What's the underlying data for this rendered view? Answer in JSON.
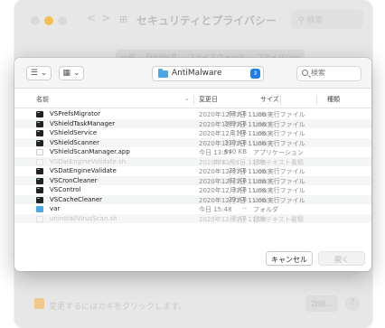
{
  "background": {
    "nav_back": "<",
    "nav_forward": ">",
    "grid_glyph": "⊞",
    "title": "セキュリティとプライバシー",
    "search_placeholder": "検索",
    "tabs": [
      "一般",
      "FileVault",
      "ファイアウォール",
      "プライバシー"
    ],
    "lock_text": "変更するにはカギをクリックします。",
    "advanced_label": "詳細...",
    "help_label": "?"
  },
  "toolbar": {
    "view_icon": "list-view-icon",
    "grid_icon": "grid-view-icon",
    "view_glyph": "☰",
    "grid_glyph": "▦",
    "chevron": "⌄",
    "location": "AntiMalware",
    "location_stepper": "⇕",
    "search_placeholder": "検索"
  },
  "columns": {
    "name": "名前",
    "date": "変更日",
    "size": "サイズ",
    "kind": "種類"
  },
  "files": [
    {
      "name": "VSPrefsMigrator",
      "date": "2020年12月1日 11:06",
      "size": "68 KB",
      "kind": "Unix実行ファイル",
      "icon": "exec",
      "enabled": true
    },
    {
      "name": "VShieldTaskManager",
      "date": "2020年12月1日 11:06",
      "size": "389 KB",
      "kind": "Unix実行ファイル",
      "icon": "exec",
      "enabled": true
    },
    {
      "name": "VShieldService",
      "date": "2020年12月1日 11:06",
      "size": "1 MB",
      "kind": "Unix実行ファイル",
      "icon": "exec",
      "enabled": true
    },
    {
      "name": "VShieldScanner",
      "date": "2020年12月1日 11:06",
      "size": "310 KB",
      "kind": "Unix実行ファイル",
      "icon": "exec",
      "enabled": true
    },
    {
      "name": "VShieldScanManager.app",
      "date": "今日 13:57",
      "size": "840 KB",
      "kind": "アプリケーション",
      "icon": "app",
      "enabled": true
    },
    {
      "name": "VSDatEngineValidate.sh",
      "date": "2020年12月1日 11:06",
      "size": "578 バイト",
      "kind": "標準テキスト書類",
      "icon": "doc",
      "enabled": false
    },
    {
      "name": "VSDatEngineValidate",
      "date": "2020年12月1日 11:06",
      "size": "28 KB",
      "kind": "Unix実行ファイル",
      "icon": "exec",
      "enabled": true
    },
    {
      "name": "VSCronCleaner",
      "date": "2020年12月1日 11:06",
      "size": "82 KB",
      "kind": "Unix実行ファイル",
      "icon": "exec",
      "enabled": true
    },
    {
      "name": "VSControl",
      "date": "2020年12月1日 11:06",
      "size": "3 KB",
      "kind": "Unix実行ファイル",
      "icon": "exec",
      "enabled": true
    },
    {
      "name": "VSCacheCleaner",
      "date": "2020年12月1日 11:06",
      "size": "29 KB",
      "kind": "Unix実行ファイル",
      "icon": "exec",
      "enabled": true
    },
    {
      "name": "var",
      "date": "今日 15:48",
      "size": "--",
      "kind": "フォルダ",
      "icon": "folder",
      "enabled": true
    },
    {
      "name": "uninstallVirusScan.sh",
      "date": "2020年12月1日 11:06",
      "size": "6 KB",
      "kind": "標準テキスト書類",
      "icon": "doc",
      "enabled": false
    }
  ],
  "footer": {
    "cancel_label": "キャンセル",
    "open_label": "開く"
  }
}
